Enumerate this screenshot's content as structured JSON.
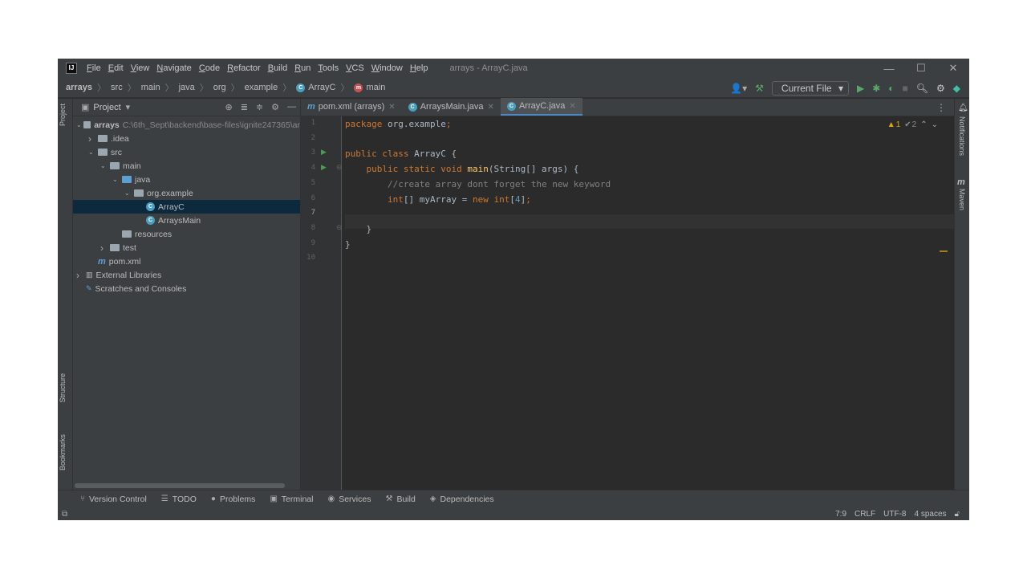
{
  "window": {
    "logo": "IJ",
    "title": "arrays - ArrayC.java",
    "menu": [
      "File",
      "Edit",
      "View",
      "Navigate",
      "Code",
      "Refactor",
      "Build",
      "Run",
      "Tools",
      "VCS",
      "Window",
      "Help"
    ],
    "controls": {
      "minimize": "—",
      "maximize": "☐",
      "close": "✕"
    }
  },
  "breadcrumb": {
    "items": [
      "arrays",
      "src",
      "main",
      "java",
      "org",
      "example",
      "ArrayC",
      "main"
    ]
  },
  "toolbar": {
    "run_config": "Current File",
    "icons": [
      "user-icon",
      "build-hammer-icon",
      "run-icon",
      "debug-icon",
      "coverage-icon",
      "stop-icon",
      "search-icon",
      "settings-icon",
      "logo-icon"
    ]
  },
  "left_strip": {
    "project": "Project",
    "structure": "Structure",
    "bookmarks": "Bookmarks"
  },
  "right_strip": {
    "notifications": "Notifications",
    "maven": "Maven",
    "maven_icon": "m"
  },
  "project": {
    "title": "Project",
    "tree": [
      {
        "label": "arrays",
        "path": "C:\\6th_Sept\\backend\\base-files\\ignite247365\\ar",
        "depth": 0,
        "arrow": "v",
        "icon": "folder",
        "bold": true
      },
      {
        "label": ".idea",
        "depth": 1,
        "arrow": ">",
        "icon": "folder"
      },
      {
        "label": "src",
        "depth": 1,
        "arrow": "v",
        "icon": "folder"
      },
      {
        "label": "main",
        "depth": 2,
        "arrow": "v",
        "icon": "folder"
      },
      {
        "label": "java",
        "depth": 3,
        "arrow": "v",
        "icon": "folder-blue"
      },
      {
        "label": "org.example",
        "depth": 4,
        "arrow": "v",
        "icon": "package"
      },
      {
        "label": "ArrayC",
        "depth": 5,
        "arrow": "",
        "icon": "class",
        "selected": true
      },
      {
        "label": "ArraysMain",
        "depth": 5,
        "arrow": "",
        "icon": "class"
      },
      {
        "label": "resources",
        "depth": 3,
        "arrow": "",
        "icon": "folder"
      },
      {
        "label": "test",
        "depth": 2,
        "arrow": ">",
        "icon": "folder"
      },
      {
        "label": "pom.xml",
        "depth": 1,
        "arrow": "",
        "icon": "maven"
      },
      {
        "label": "External Libraries",
        "depth": 0,
        "arrow": ">",
        "icon": "library"
      },
      {
        "label": "Scratches and Consoles",
        "depth": 0,
        "arrow": "",
        "icon": "scratch"
      }
    ]
  },
  "tabs": [
    {
      "label": "pom.xml (arrays)",
      "icon": "m"
    },
    {
      "label": "ArraysMain.java",
      "icon": "C"
    },
    {
      "label": "ArrayC.java",
      "icon": "C",
      "active": true
    }
  ],
  "inspections": {
    "warnings": "1",
    "ok": "2"
  },
  "code": {
    "line_numbers": [
      "1",
      "2",
      "3",
      "4",
      "5",
      "6",
      "7",
      "8",
      "9",
      "10"
    ],
    "lines": [
      [
        {
          "t": "package ",
          "c": "kw"
        },
        {
          "t": "org.example",
          "c": ""
        },
        {
          "t": ";",
          "c": "kw"
        }
      ],
      [],
      [
        {
          "t": "public class ",
          "c": "kw"
        },
        {
          "t": "ArrayC ",
          "c": ""
        },
        {
          "t": "{",
          "c": ""
        }
      ],
      [
        {
          "t": "    public static void ",
          "c": "kw"
        },
        {
          "t": "main",
          "c": "fn"
        },
        {
          "t": "(String[] args) {",
          "c": ""
        }
      ],
      [
        {
          "t": "        //create array dont forget the new keyword",
          "c": "cm"
        }
      ],
      [
        {
          "t": "        int",
          "c": "kw"
        },
        {
          "t": "[] myArray = ",
          "c": ""
        },
        {
          "t": "new int",
          "c": "kw"
        },
        {
          "t": "[",
          "c": ""
        },
        {
          "t": "4",
          "c": "num"
        },
        {
          "t": "]",
          "c": ""
        },
        {
          "t": ";",
          "c": "kw"
        }
      ],
      [],
      [
        {
          "t": "    }",
          "c": ""
        }
      ],
      [
        {
          "t": "}",
          "c": ""
        }
      ],
      []
    ]
  },
  "bottom_tools": [
    {
      "label": "Version Control",
      "icon": "vcs-icon"
    },
    {
      "label": "TODO",
      "icon": "todo-icon"
    },
    {
      "label": "Problems",
      "icon": "problems-icon"
    },
    {
      "label": "Terminal",
      "icon": "terminal-icon"
    },
    {
      "label": "Services",
      "icon": "services-icon"
    },
    {
      "label": "Build",
      "icon": "build-icon"
    },
    {
      "label": "Dependencies",
      "icon": "dependencies-icon"
    }
  ],
  "status": {
    "position": "7:9",
    "line_sep": "CRLF",
    "encoding": "UTF-8",
    "indent": "4 spaces"
  }
}
